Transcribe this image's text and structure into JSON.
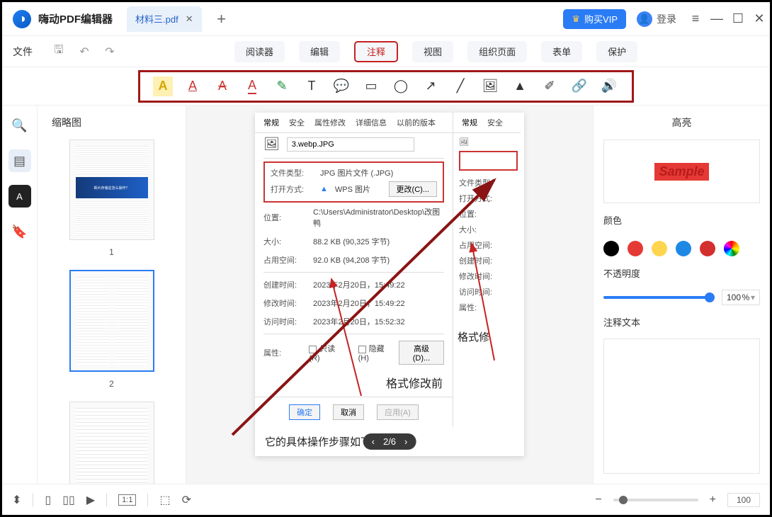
{
  "app": {
    "title": "嗨动PDF编辑器"
  },
  "tab": {
    "name": "材料三.pdf"
  },
  "header": {
    "vip": "购买VIP",
    "login": "登录"
  },
  "menu": {
    "file": "文件"
  },
  "modes": {
    "reader": "阅读器",
    "edit": "编辑",
    "annotate": "注释",
    "view": "视图",
    "organize": "组织页面",
    "form": "表单",
    "protect": "保护"
  },
  "side": {
    "thumb_title": "缩略图"
  },
  "thumbs": {
    "p1": "1",
    "p2": "2",
    "banner": "新片存储这怎么操作？"
  },
  "doc": {
    "tabs": {
      "general": "常规",
      "security": "安全",
      "attr": "属性修改",
      "detail": "详细信息",
      "prev": "以前的版本"
    },
    "filename_field": "3.webp.JPG",
    "filetype_l": "文件类型:",
    "filetype_v": "JPG 图片文件 (.JPG)",
    "open_l": "打开方式:",
    "open_v": "WPS 图片",
    "change": "更改(C)...",
    "loc_l": "位置:",
    "loc_v": "C:\\Users\\Administrator\\Desktop\\改图鸭",
    "size_l": "大小:",
    "size_v": "88.2 KB (90,325 字节)",
    "disk_l": "占用空间:",
    "disk_v": "92.0 KB (94,208 字节)",
    "created_l": "创建时间:",
    "created_v": "2023年2月20日，15:49:22",
    "mod_l": "修改时间:",
    "mod_v": "2023年2月20日，15:49:22",
    "acc_l": "访问时间:",
    "acc_v": "2023年2月20日，15:52:32",
    "attrs_l": "属性:",
    "readonly": "只读(R)",
    "hidden": "隐藏(H)",
    "adv": "高级(D)...",
    "caption_left": "格式修改前",
    "caption_right": "格式修",
    "ok": "确定",
    "cancel": "取消",
    "apply": "应用(A)",
    "body": "它的具体操作步骤如下："
  },
  "pagepill": {
    "page": "2/6"
  },
  "right": {
    "title": "高亮",
    "sample": "Sample",
    "color": "颜色",
    "opacity": "不透明度",
    "opacity_val": "100",
    "pct": "%",
    "note": "注释文本"
  },
  "bottom": {
    "ratio": "1:1",
    "zoom": "100"
  }
}
